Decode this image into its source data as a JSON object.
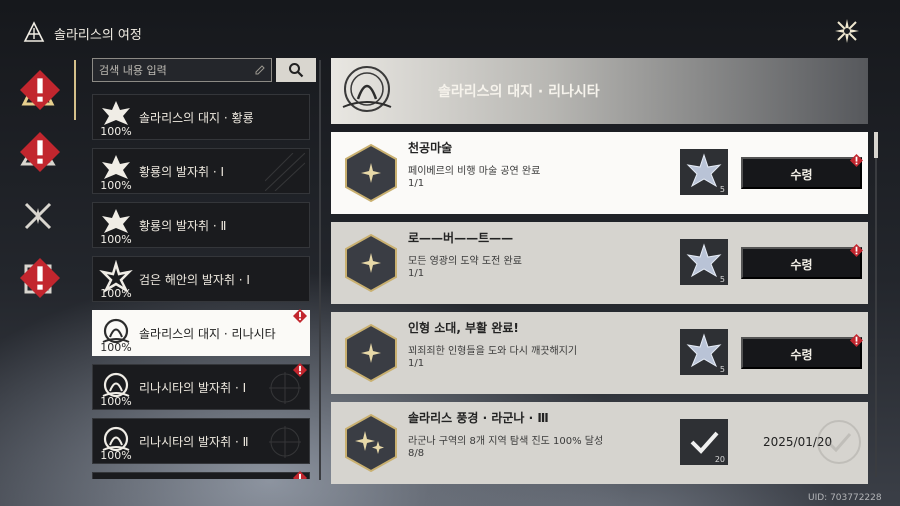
{
  "app": {
    "title": "솔라리스의 여정",
    "logo_icon": "solaris-logo-icon",
    "close_icon": "close-star-icon"
  },
  "rail": {
    "items": [
      {
        "icon": "solaris-emblem-icon",
        "active": true,
        "badge": true
      },
      {
        "icon": "mountain-emblem-icon",
        "active": false,
        "badge": true
      },
      {
        "icon": "crossed-blades-icon",
        "active": false,
        "badge": false
      },
      {
        "icon": "journal-emblem-icon",
        "active": false,
        "badge": true
      }
    ]
  },
  "search": {
    "placeholder": "검색 내용 입력",
    "value": ""
  },
  "chapters": [
    {
      "label": "솔라리스의 대지 · 황룡",
      "progress": "100%",
      "active": false,
      "badge": false
    },
    {
      "label": "황룡의 발자취 · Ⅰ",
      "progress": "100%",
      "active": false,
      "badge": false
    },
    {
      "label": "황룡의 발자취 · Ⅱ",
      "progress": "100%",
      "active": false,
      "badge": false
    },
    {
      "label": "검은 해안의 발자취 · Ⅰ",
      "progress": "100%",
      "active": false,
      "badge": false
    },
    {
      "label": "솔라리스의 대지 · 리나시타",
      "progress": "100%",
      "active": true,
      "badge": true
    },
    {
      "label": "리나시타의 발자취 · Ⅰ",
      "progress": "100%",
      "active": false,
      "badge": true
    },
    {
      "label": "리나시타의 발자취 · Ⅱ",
      "progress": "100%",
      "active": false,
      "badge": false
    }
  ],
  "header": {
    "title": "솔라리스의 대지 · 리나시타"
  },
  "quests": [
    {
      "title": "천공마술",
      "desc": "페이베르의 비행 마술 공연 완료",
      "count": "1/1",
      "reward_qty": "5",
      "state": "claim",
      "claim_label": "수령",
      "icon": "sparkle-icon"
    },
    {
      "title": "로——버——트——",
      "desc": "모든 영광의 도약 도전 완료",
      "count": "1/1",
      "reward_qty": "5",
      "state": "claim",
      "claim_label": "수령",
      "icon": "sparkle-icon"
    },
    {
      "title": "인형 소대, 부활 완료!",
      "desc": "꾀죄죄한 인형들을 도와 다시 깨끗해지기",
      "count": "1/1",
      "reward_qty": "5",
      "state": "claim",
      "claim_label": "수령",
      "icon": "sparkle-icon"
    },
    {
      "title": "솔라리스 풍경 · 라군나 · Ⅲ",
      "desc": "라군나 구역의 8개 지역 탐색 진도 100% 달성",
      "count": "8/8",
      "reward_qty": "20",
      "state": "done",
      "date": "2025/01/20",
      "icon": "double-sparkle-icon"
    }
  ],
  "footer": {
    "uid": "UID: 703772228"
  }
}
